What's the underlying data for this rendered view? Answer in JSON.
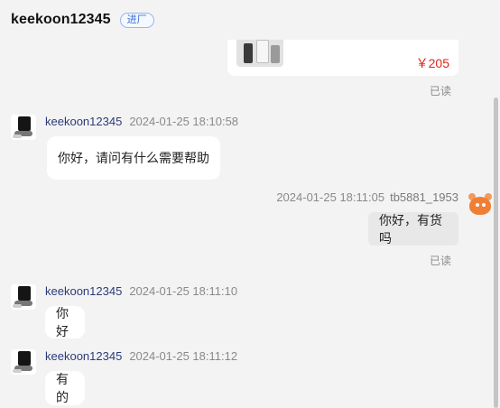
{
  "header": {
    "title": "keekoon12345",
    "badge": "进厂"
  },
  "product": {
    "price": "￥205",
    "read_status": "已读"
  },
  "messages": [
    {
      "sender": "keekoon12345",
      "time": "2024-01-25 18:10:58",
      "text": "你好，请问有什么需要帮助"
    },
    {
      "sender": "tb5881_1953",
      "time": "2024-01-25 18:11:05",
      "text": "你好，有货吗",
      "read_status": "已读"
    },
    {
      "sender": "keekoon12345",
      "time": "2024-01-25 18:11:10",
      "text": "你好"
    },
    {
      "sender": "keekoon12345",
      "time": "2024-01-25 18:11:12",
      "text": "有的"
    }
  ],
  "colors": {
    "price": "#e0251b",
    "badge": "#3b6fd4",
    "sender_name": "#2d3a7a",
    "my_avatar": "#f07f35"
  }
}
